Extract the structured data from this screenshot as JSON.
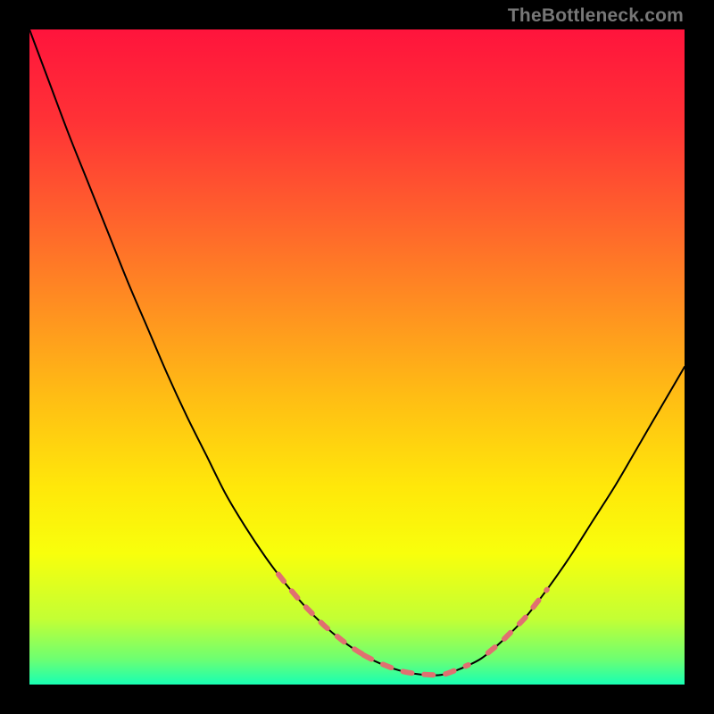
{
  "watermark": "TheBottleneck.com",
  "gradient_stops": [
    {
      "offset": 0.0,
      "color": "#ff143c"
    },
    {
      "offset": 0.14,
      "color": "#ff3236"
    },
    {
      "offset": 0.28,
      "color": "#ff5f2d"
    },
    {
      "offset": 0.42,
      "color": "#ff8e21"
    },
    {
      "offset": 0.56,
      "color": "#ffbd14"
    },
    {
      "offset": 0.7,
      "color": "#ffe80a"
    },
    {
      "offset": 0.8,
      "color": "#f8ff0c"
    },
    {
      "offset": 0.9,
      "color": "#c3ff34"
    },
    {
      "offset": 0.96,
      "color": "#6fff70"
    },
    {
      "offset": 1.0,
      "color": "#18ffb4"
    }
  ],
  "curve_color": "#000000",
  "curve_width": 2,
  "dash_color": "#e07070",
  "dash_width": 6,
  "chart_data": {
    "type": "line",
    "title": "",
    "xlabel": "",
    "ylabel": "",
    "xlim": [
      0,
      100
    ],
    "ylim": [
      0,
      100
    ],
    "series": [
      {
        "name": "bottleneck-curve",
        "x": [
          0,
          3,
          6,
          9,
          12,
          15,
          18,
          21,
          24,
          27,
          30,
          33,
          36,
          39,
          42,
          45,
          48,
          51,
          54,
          57,
          60,
          63,
          66,
          69,
          72,
          75.5,
          79,
          82.5,
          86,
          89.5,
          93,
          96.5,
          100
        ],
        "y": [
          100,
          92,
          84,
          76.5,
          69,
          61.5,
          54.5,
          47.5,
          41,
          35,
          29,
          24,
          19.5,
          15.5,
          12,
          9,
          6.5,
          4.5,
          3,
          2,
          1.5,
          1.5,
          2.5,
          4,
          6.5,
          10,
          14.5,
          19.5,
          25,
          30.5,
          36.5,
          42.5,
          48.5
        ]
      }
    ],
    "dashed_segments": [
      {
        "x": [
          38,
          52
        ],
        "y": [
          17,
          4
        ]
      },
      {
        "x": [
          51,
          67
        ],
        "y": [
          4.5,
          3
        ]
      },
      {
        "x": [
          70,
          79
        ],
        "y": [
          5,
          15
        ]
      }
    ]
  }
}
